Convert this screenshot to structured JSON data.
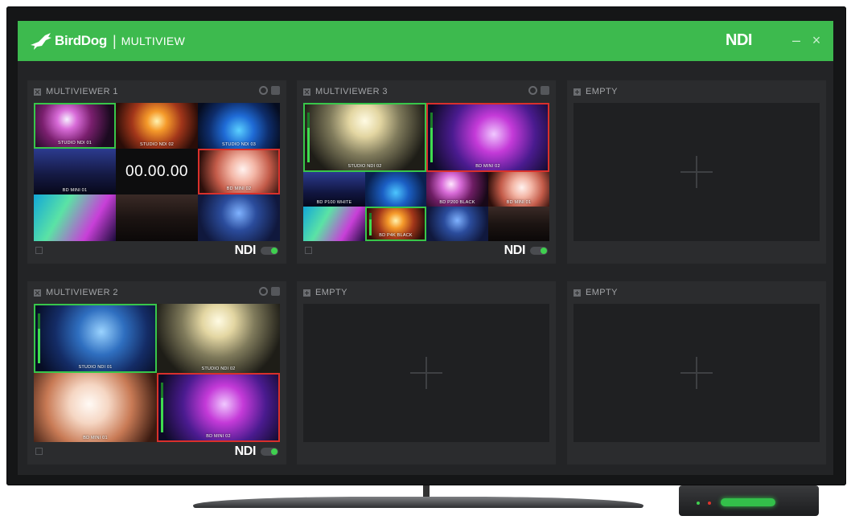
{
  "titlebar": {
    "brand": "BirdDog",
    "separator": "|",
    "product": "MULTIVIEW",
    "ndi_logo": "NDI",
    "minimize_label": "–",
    "close_label": "×"
  },
  "panels": {
    "mv1": {
      "title": "MULTIVIEWER 1",
      "ndi_label": "NDI",
      "timer": "00.00.00",
      "tiles": [
        "STUDIO NDI 01",
        "STUDIO NDI 02",
        "STUDIO NDI 03",
        "BD MINI 01",
        "BD MINI 02"
      ]
    },
    "mv3": {
      "title": "MULTIVIEWER 3",
      "ndi_label": "NDI",
      "tiles": [
        "STUDIO NDI 02",
        "BD MINI 02",
        "BD P100 WHITE",
        "BD P200 BLACK",
        "BD MINI 01",
        "BD P4K BLACK"
      ]
    },
    "mv2": {
      "title": "MULTIVIEWER 2",
      "ndi_label": "NDI",
      "tiles": [
        "STUDIO NDI 01",
        "STUDIO NDI 02",
        "BD MINI 01",
        "BD MINI 02"
      ]
    },
    "empty_label": "EMPTY"
  },
  "colors": {
    "brand_green": "#3dba4e",
    "live_green": "#38c64a",
    "live_red": "#d9302b"
  }
}
